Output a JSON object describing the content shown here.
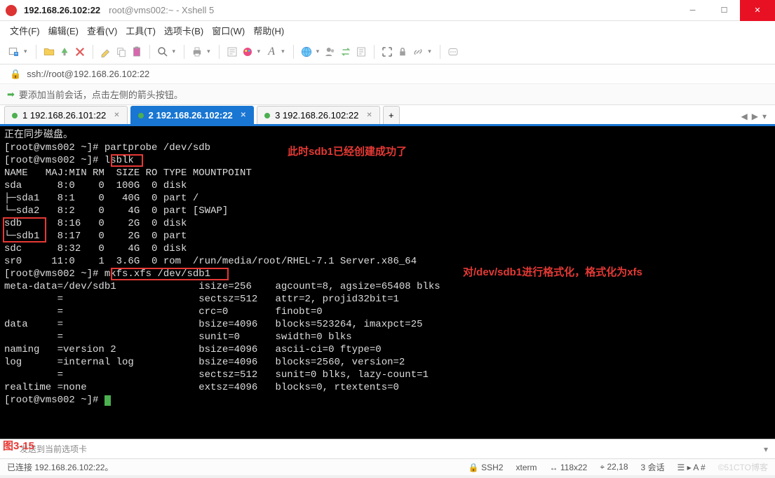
{
  "title": {
    "host": "192.168.26.102:22",
    "session": "root@vms002:~ - Xshell 5"
  },
  "menu": {
    "file": "文件(F)",
    "edit": "编辑(E)",
    "view": "查看(V)",
    "tools": "工具(T)",
    "tabs": "选项卡(B)",
    "window": "窗口(W)",
    "help": "帮助(H)"
  },
  "address": "ssh://root@192.168.26.102:22",
  "tip": "要添加当前会话，点击左侧的箭头按钮。",
  "tabs": [
    {
      "label": "1 192.168.26.101:22",
      "active": false
    },
    {
      "label": "2 192.168.26.102:22",
      "active": true
    },
    {
      "label": "3 192.168.26.102:22",
      "active": false
    }
  ],
  "terminal": {
    "lines": [
      "正在同步磁盘。",
      "[root@vms002 ~]# partprobe /dev/sdb",
      "[root@vms002 ~]# lsblk",
      "NAME   MAJ:MIN RM  SIZE RO TYPE MOUNTPOINT",
      "sda      8:0    0  100G  0 disk",
      "├─sda1   8:1    0   40G  0 part /",
      "└─sda2   8:2    0    4G  0 part [SWAP]",
      "sdb      8:16   0    2G  0 disk",
      "└─sdb1   8:17   0    2G  0 part",
      "sdc      8:32   0    4G  0 disk",
      "sr0     11:0    1  3.6G  0 rom  /run/media/root/RHEL-7.1 Server.x86_64",
      "[root@vms002 ~]# mkfs.xfs /dev/sdb1",
      "meta-data=/dev/sdb1              isize=256    agcount=8, agsize=65408 blks",
      "         =                       sectsz=512   attr=2, projid32bit=1",
      "         =                       crc=0        finobt=0",
      "data     =                       bsize=4096   blocks=523264, imaxpct=25",
      "         =                       sunit=0      swidth=0 blks",
      "naming   =version 2              bsize=4096   ascii-ci=0 ftype=0",
      "log      =internal log           bsize=4096   blocks=2560, version=2",
      "         =                       sectsz=512   sunit=0 blks, lazy-count=1",
      "realtime =none                   extsz=4096   blocks=0, rtextents=0",
      "[root@vms002 ~]# "
    ],
    "anno1": "此时sdb1已经创建成功了",
    "anno2": "对/dev/sdb1进行格式化，格式化为xfs",
    "figlabel": "图3-15"
  },
  "sendbar": {
    "placeholder": "发送到当前选项卡"
  },
  "status": {
    "conn": "已连接 192.168.26.102:22。",
    "proto": "SSH2",
    "term": "xterm",
    "size": "118x22",
    "pos": "22,18",
    "sess": "3 会话",
    "watermark": "©51CTO博客"
  },
  "icons": {
    "lock": "🔒",
    "arrow": "➡",
    "plus": "+",
    "nav_l": "◀",
    "nav_r": "▶",
    "ssh_icon": "🔒",
    "term_icon": "⎘",
    "size_icon": "↔",
    "pos_icon": "⌖",
    "list_icon": "☰"
  }
}
